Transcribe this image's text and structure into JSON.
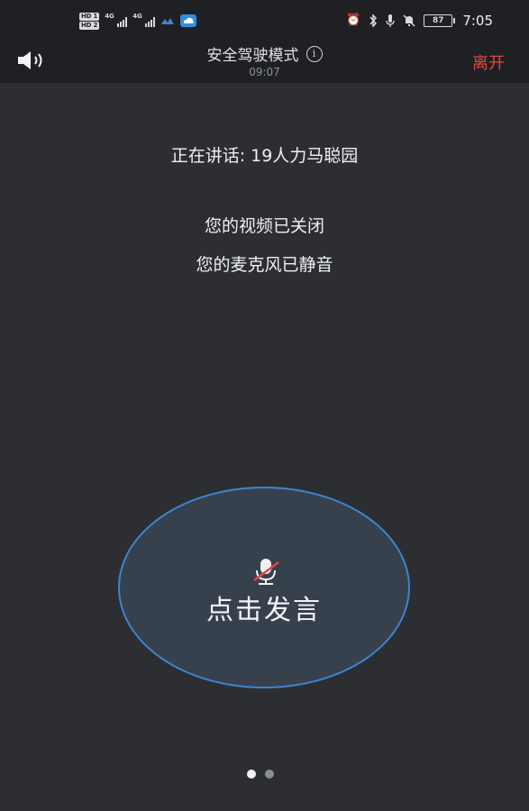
{
  "status_bar": {
    "hd_badges": [
      "HD 1",
      "HD 2"
    ],
    "network": [
      "4G",
      "4G"
    ],
    "battery": "87",
    "time": "7:05",
    "icons": [
      "alarm-icon",
      "bluetooth-icon",
      "mic-icon",
      "silent-bell-icon"
    ]
  },
  "header": {
    "title": "安全驾驶模式",
    "info_icon": "i",
    "timer": "09:07",
    "leave_label": "离开",
    "leave_color": "#e5463f"
  },
  "content": {
    "speaking": "正在讲话: 19人力马聪园",
    "video_status": "您的视频已关闭",
    "mic_status": "您的麦克风已静音"
  },
  "talk_button": {
    "label": "点击发言",
    "icon": "mic-muted-icon",
    "accent": "#3d84d2"
  },
  "pager": {
    "pages": 2,
    "active": 1
  }
}
